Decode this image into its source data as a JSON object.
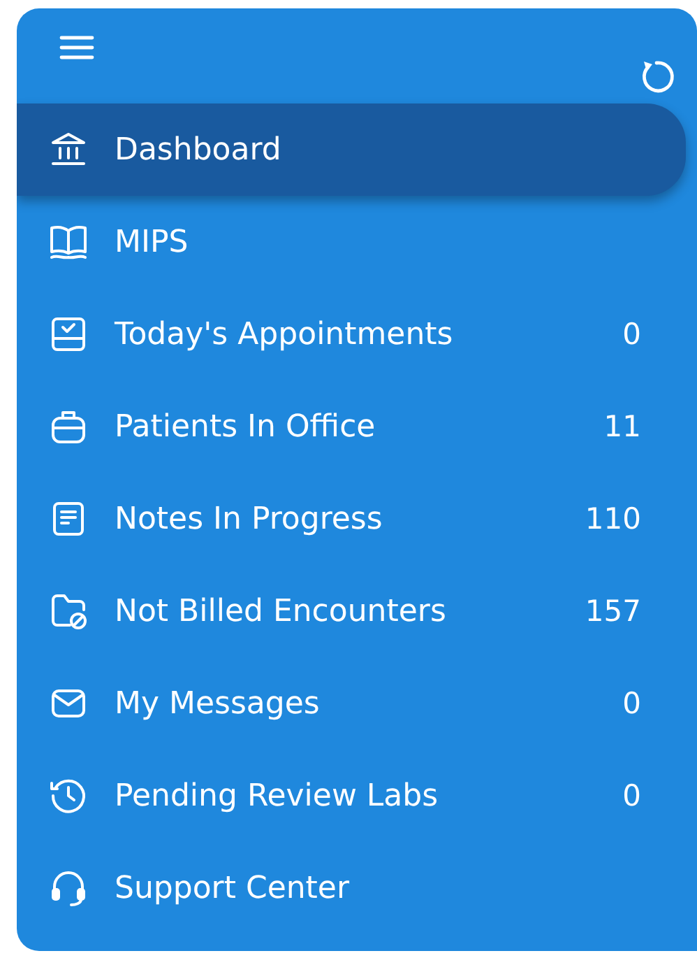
{
  "sidebar": {
    "items": [
      {
        "label": "Dashboard",
        "selected": true
      },
      {
        "label": "MIPS",
        "selected": false
      },
      {
        "label": "Today's Appointments",
        "count": "0",
        "selected": false
      },
      {
        "label": "Patients In Office",
        "count": "11",
        "selected": false
      },
      {
        "label": "Notes In Progress",
        "count": "110",
        "selected": false
      },
      {
        "label": "Not Billed Encounters",
        "count": "157",
        "selected": false
      },
      {
        "label": "My Messages",
        "count": "0",
        "selected": false
      },
      {
        "label": "Pending Review Labs",
        "count": "0",
        "selected": false
      },
      {
        "label": "Support Center",
        "selected": false
      }
    ]
  }
}
